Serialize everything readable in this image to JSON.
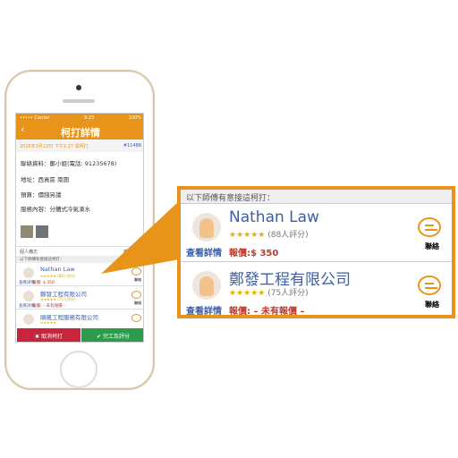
{
  "phone": {
    "status": {
      "carrier": "••••• Carrier",
      "time": "9:23",
      "battery": "100%"
    },
    "title": "柯打詳情",
    "date": "2016年3月22日 下午1:27 需柯打",
    "order_id": "#11488",
    "details": [
      "聯絡資料：鄭小姐(電話: 91235678)",
      "地址：西貢區 南圍",
      "預算：價錢另議",
      "服務內容：分體式冷氣滴水"
    ],
    "memo_label": "個人備忘",
    "memo_add": "新增備忘",
    "list_header": "以下師傅有意接這柯打：",
    "masters": [
      {
        "name": "Nathan Law",
        "rating": "★★★★★ (88人評分)",
        "view": "查看詳情",
        "price": "報價: $ 350",
        "contact": "聯絡"
      },
      {
        "name": "鄭發工程有限公司",
        "rating": "★★★★★ (75人評分)",
        "view": "查看詳情",
        "price": "報價: – 未有報價 –",
        "contact": "聯絡"
      },
      {
        "name": "順風工程服務有限公司",
        "rating": "★★★★★",
        "view": "",
        "price": "",
        "contact": ""
      }
    ],
    "cancel_label": "✖ 取消柯打",
    "complete_label": "✔ 完工及評分"
  },
  "callout": {
    "header": "以下師傅有意接這柯打：",
    "rows": [
      {
        "name": "Nathan Law",
        "stars": "★★★★★",
        "count": "(88人評分)",
        "view": "查看詳情",
        "price": "報價:$ 350",
        "contact": "聯絡"
      },
      {
        "name": "鄭發工程有限公司",
        "stars": "★★★★★",
        "count": "(75人評分)",
        "view": "查看詳情",
        "price": "報價: – 未有報價 –",
        "contact": "聯絡"
      }
    ]
  },
  "colors": {
    "accent": "#e8941a",
    "link": "#3b5ea7",
    "price": "#c0392b",
    "cancel": "#c8243c",
    "complete": "#2e9a4c"
  }
}
